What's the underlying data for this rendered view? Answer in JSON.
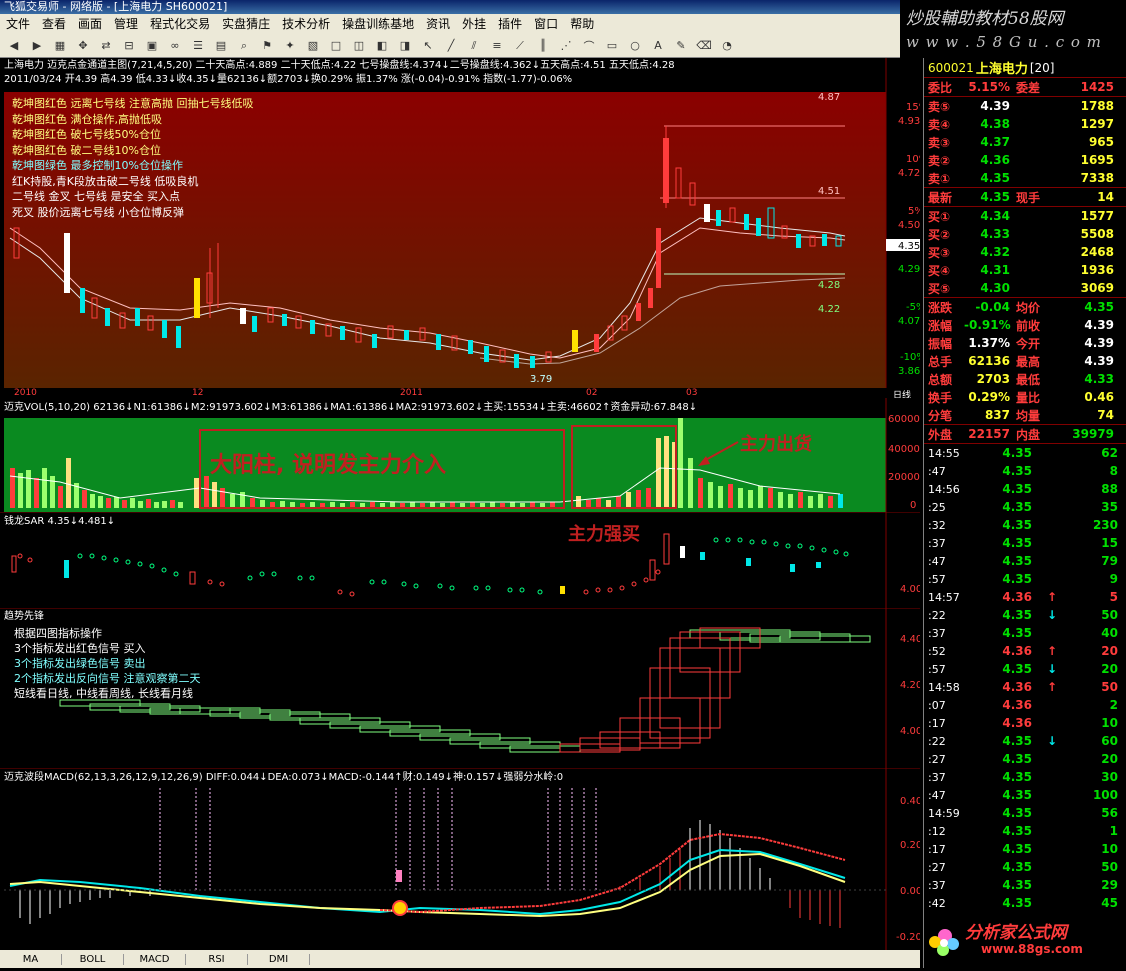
{
  "window": {
    "title": "飞狐交易师 - 网络版 - [上海电力 SH600021]"
  },
  "menu": [
    "文件",
    "查看",
    "画面",
    "管理",
    "程式化交易",
    "实盘猜庄",
    "技术分析",
    "操盘训练基地",
    "资讯",
    "外挂",
    "插件",
    "窗口",
    "帮助"
  ],
  "brand": {
    "line1": "炒股輔助教材58股网",
    "line2": "w w w . 5 8 G u . c o m"
  },
  "main_chart": {
    "header1": "上海电力 迈克点金通道主图(7,21,4,5,20) 二十天高点:4.889 二十天低点:4.22 七号操盘线:4.374↓二号操盘线:4.362↓五天高点:4.51 五天低点:4.28",
    "header2": "2011/03/24 开4.39 高4.39 低4.33↓收4.35↓量62136↓额2703↓换0.29% 振1.37% 涨(-0.04)-0.91% 指数(-1.77)-0.06%",
    "notes": [
      "乾坤图红色 远离七号线 注意高抛 回抽七号线低吸",
      "乾坤图红色 满仓操作,高抛低吸",
      "乾坤图红色 破七号线50%仓位",
      "乾坤图红色 破二号线10%仓位",
      "乾坤图绿色 最多控制10%仓位操作",
      "红K持股,青K段放击破二号线 低吸良机",
      "二号线 金叉 七号线 是安全 买入点",
      "死叉 股价远离七号线 小仓位博反弹"
    ],
    "right_axis": [
      "15%",
      "4.93",
      "10%",
      "4.72",
      "5%",
      "4.50",
      "4.35",
      "4.29",
      "-5%",
      "4.07",
      "-10%",
      "3.86"
    ],
    "price_labels": {
      "top": "4.87",
      "mid": "4.51",
      "low1": "4.28",
      "low2": "4.22",
      "bottom": "3.79"
    }
  },
  "date_axis": [
    "2010",
    "12",
    "2011",
    "02",
    "03"
  ],
  "date_axis_right": "日线",
  "volume": {
    "header": "迈克VOL(5,10,20) 62136↓N1:61386↓M2:91973.602↓M3:61386↓MA1:61386↓MA2:91973.602↓主买:15534↓主卖:46602↑资金异动:67.848↓",
    "axis": [
      "600000",
      "400000",
      "200000",
      "0"
    ],
    "annotation_box": "大阳柱, 说明发主力介入",
    "annotation_strong": "主力强买",
    "annotation_arrow": "主力出货"
  },
  "sar": {
    "header": "钱龙SAR 4.35↓4.481↓",
    "axis": [
      "4.00"
    ]
  },
  "trend": {
    "header": "趋势先锋",
    "notes": [
      "根据四图指标操作",
      "3个指标发出红色信号 买入",
      "3个指标发出绿色信号 卖出",
      "2个指标发出反向信号 注意观察第二天",
      "短线看日线, 中线看周线, 长线看月线"
    ],
    "axis": [
      "4.40",
      "4.20",
      "4.00"
    ]
  },
  "macd": {
    "header": "迈克波段MACD(62,13,3,26,12,9,12,26,9) DIFF:0.044↓DEA:0.073↓MACD:-0.144↑财:0.149↓神:0.157↓强弱分水岭:0",
    "axis": [
      "0.40",
      "0.20",
      "0.00",
      "-0.20"
    ]
  },
  "tabs": [
    "MA",
    "BOLL",
    "MACD",
    "RSI",
    "DMI"
  ],
  "quote": {
    "code": "600021",
    "name": "上海电力",
    "suffix": "[20]",
    "weibi_label": "委比",
    "weibi": "5.15%",
    "weicha_label": "委差",
    "weicha": "1425",
    "sells": [
      {
        "label": "卖⑤",
        "price": "4.39",
        "vol": "1788"
      },
      {
        "label": "卖④",
        "price": "4.38",
        "vol": "1297"
      },
      {
        "label": "卖③",
        "price": "4.37",
        "vol": "965"
      },
      {
        "label": "卖②",
        "price": "4.36",
        "vol": "1695"
      },
      {
        "label": "卖①",
        "price": "4.35",
        "vol": "7338"
      }
    ],
    "latest_label": "最新",
    "latest": "4.35",
    "xianshou_label": "现手",
    "xianshou": "14",
    "buys": [
      {
        "label": "买①",
        "price": "4.34",
        "vol": "1577"
      },
      {
        "label": "买②",
        "price": "4.33",
        "vol": "5508"
      },
      {
        "label": "买③",
        "price": "4.32",
        "vol": "2468"
      },
      {
        "label": "买④",
        "price": "4.31",
        "vol": "1936"
      },
      {
        "label": "买⑤",
        "price": "4.30",
        "vol": "3069"
      }
    ],
    "stats": [
      {
        "l1": "涨跌",
        "v1": "-0.04",
        "l2": "均价",
        "v2": "4.35"
      },
      {
        "l1": "涨幅",
        "v1": "-0.91%",
        "l2": "前收",
        "v2": "4.39"
      },
      {
        "l1": "振幅",
        "v1": "1.37%",
        "l2": "今开",
        "v2": "4.39"
      },
      {
        "l1": "总手",
        "v1": "62136",
        "l2": "最高",
        "v2": "4.39"
      },
      {
        "l1": "总额",
        "v1": "2703",
        "l2": "最低",
        "v2": "4.33"
      },
      {
        "l1": "换手",
        "v1": "0.29%",
        "l2": "量比",
        "v2": "0.46"
      },
      {
        "l1": "分笔",
        "v1": "837",
        "l2": "均量",
        "v2": "74"
      }
    ],
    "waipan_label": "外盘",
    "waipan": "22157",
    "neipan_label": "内盘",
    "neipan": "39979",
    "ticks": [
      {
        "t": "14:55",
        "p": "4.35",
        "a": "",
        "v": "62"
      },
      {
        "t": ":47",
        "p": "4.35",
        "a": "",
        "v": "8"
      },
      {
        "t": "14:56",
        "p": "4.35",
        "a": "",
        "v": "88"
      },
      {
        "t": ":25",
        "p": "4.35",
        "a": "",
        "v": "35"
      },
      {
        "t": ":32",
        "p": "4.35",
        "a": "",
        "v": "230"
      },
      {
        "t": ":37",
        "p": "4.35",
        "a": "",
        "v": "15"
      },
      {
        "t": ":47",
        "p": "4.35",
        "a": "",
        "v": "79"
      },
      {
        "t": ":57",
        "p": "4.35",
        "a": "",
        "v": "9"
      },
      {
        "t": "14:57",
        "p": "4.36",
        "a": "↑",
        "v": "5"
      },
      {
        "t": ":22",
        "p": "4.35",
        "a": "↓",
        "v": "50"
      },
      {
        "t": ":37",
        "p": "4.35",
        "a": "",
        "v": "40"
      },
      {
        "t": ":52",
        "p": "4.36",
        "a": "↑",
        "v": "20"
      },
      {
        "t": ":57",
        "p": "4.35",
        "a": "↓",
        "v": "20"
      },
      {
        "t": "14:58",
        "p": "4.36",
        "a": "↑",
        "v": "50"
      },
      {
        "t": ":07",
        "p": "4.36",
        "a": "",
        "v": "2"
      },
      {
        "t": ":17",
        "p": "4.36",
        "a": "",
        "v": "10"
      },
      {
        "t": ":22",
        "p": "4.35",
        "a": "↓",
        "v": "60"
      },
      {
        "t": ":27",
        "p": "4.35",
        "a": "",
        "v": "20"
      },
      {
        "t": ":37",
        "p": "4.35",
        "a": "",
        "v": "30"
      },
      {
        "t": ":47",
        "p": "4.35",
        "a": "",
        "v": "100"
      },
      {
        "t": "14:59",
        "p": "4.35",
        "a": "",
        "v": "56"
      },
      {
        "t": ":12",
        "p": "4.35",
        "a": "",
        "v": "1"
      },
      {
        "t": ":17",
        "p": "4.35",
        "a": "",
        "v": "10"
      },
      {
        "t": ":27",
        "p": "4.35",
        "a": "",
        "v": "50"
      },
      {
        "t": ":37",
        "p": "4.35",
        "a": "",
        "v": "29"
      },
      {
        "t": ":42",
        "p": "4.35",
        "a": "",
        "v": "45"
      }
    ]
  },
  "logo2": {
    "text": "分析家公式网",
    "url": "www.88gs.com"
  },
  "colors": {
    "up": "#ff3c3c",
    "down": "#00e8e8",
    "main_bg_top": "#8b0000",
    "main_bg_bottom": "#5a2400",
    "vol_bg": "#0a8a20"
  }
}
